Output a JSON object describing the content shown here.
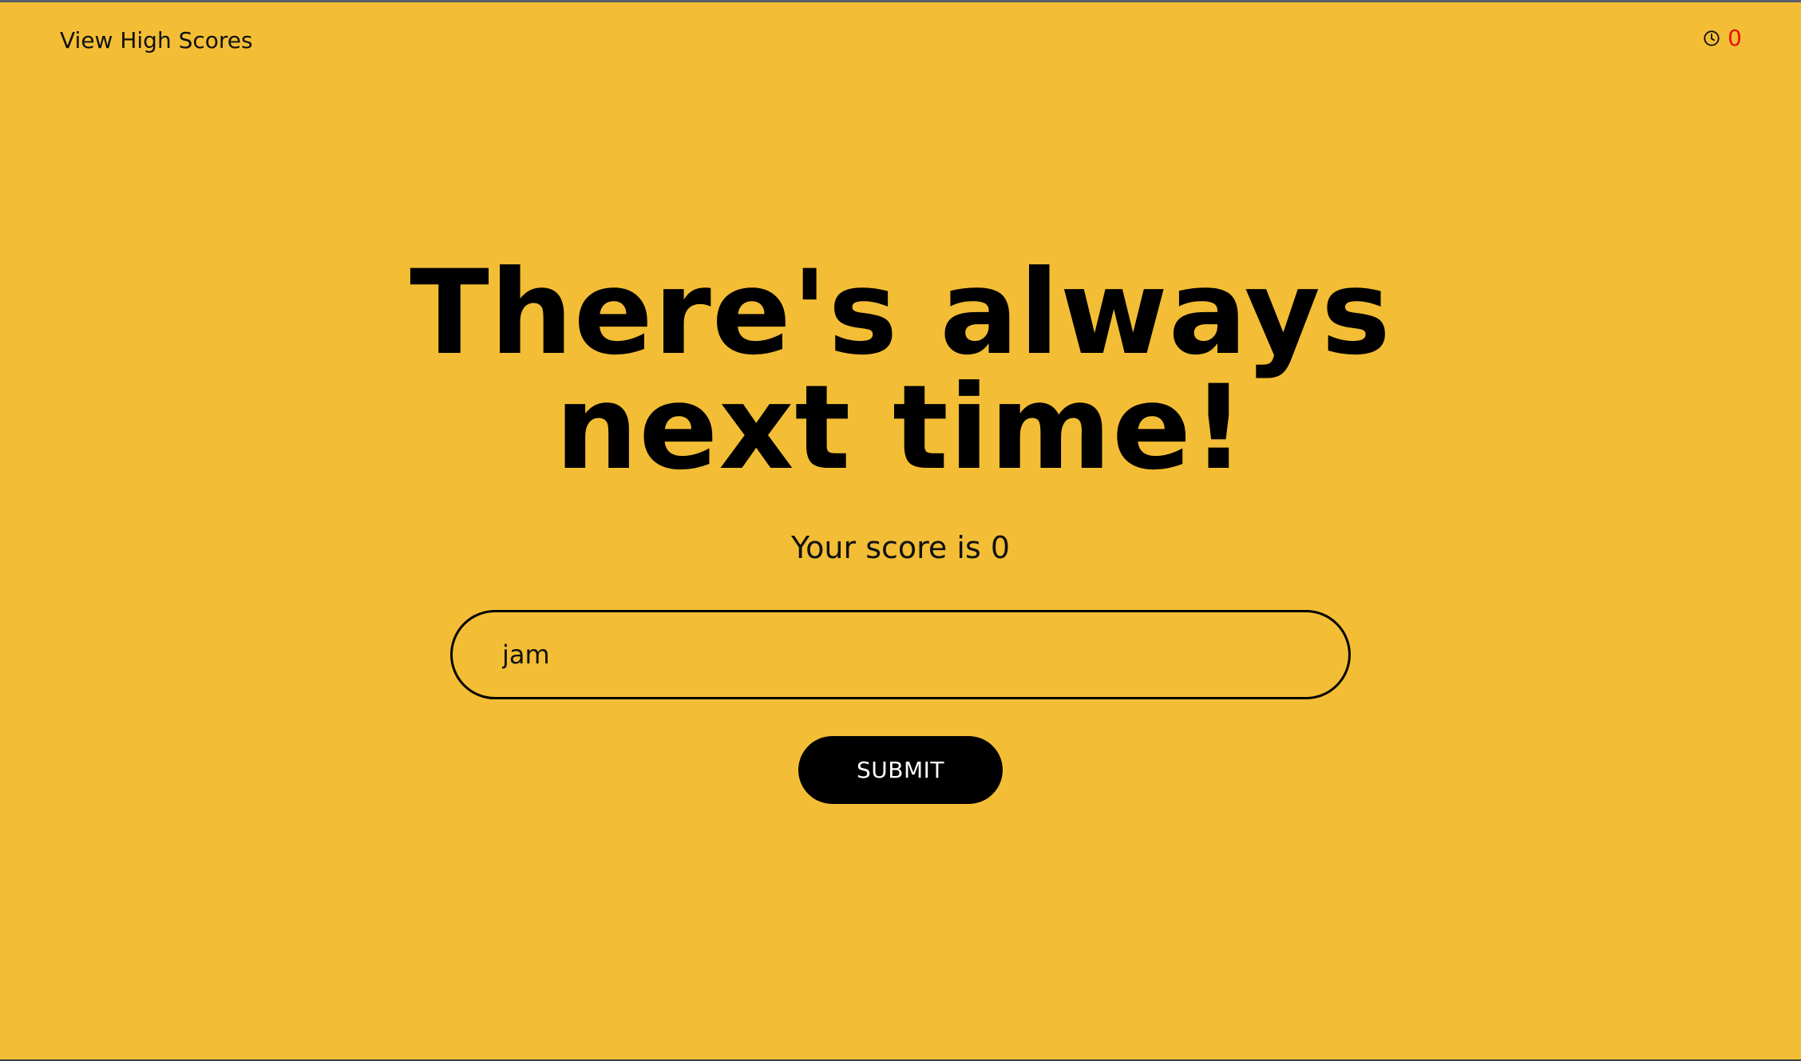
{
  "header": {
    "high_scores_label": "View High Scores",
    "timer_icon": "clock-icon",
    "timer_value": "0",
    "timer_color": "#e8110c"
  },
  "main": {
    "headline_line1": "There's always",
    "headline_line2": "next time!",
    "score_text": "Your score is 0",
    "initials_value": "jam",
    "submit_label": "SUBMIT"
  },
  "theme": {
    "background": "#f3be35",
    "button_background": "#000000",
    "button_text": "#ffffff"
  }
}
